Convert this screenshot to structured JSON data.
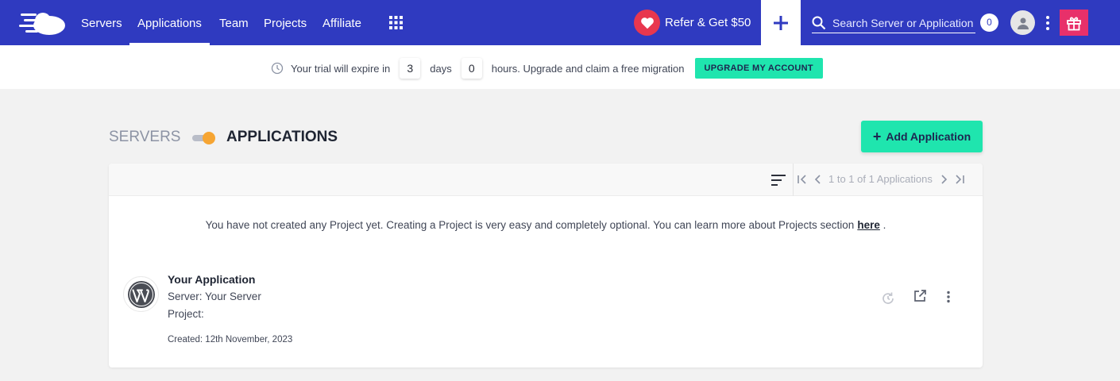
{
  "nav": {
    "items": [
      "Servers",
      "Applications",
      "Team",
      "Projects",
      "Affiliate"
    ],
    "active": "Applications",
    "refer_label": "Refer & Get $50",
    "search_placeholder": "Search Server or Application",
    "notification_count": "0"
  },
  "trial": {
    "prefix": "Your trial will expire in",
    "days_value": "3",
    "days_label": "days",
    "hours_value": "0",
    "hours_label": "hours. Upgrade and claim a free migration",
    "upgrade_label": "UPGRADE MY ACCOUNT"
  },
  "header": {
    "servers_label": "SERVERS",
    "applications_label": "APPLICATIONS",
    "add_button": "Add Application"
  },
  "list": {
    "pager_text": "1 to 1 of 1 Applications",
    "notice_text": "You have not created any Project yet. Creating a Project is very easy and completely optional. You can learn more about Projects section",
    "notice_link": "here",
    "notice_suffix": ".",
    "apps": [
      {
        "name": "Your Application",
        "server": "Server: Your Server",
        "project": "Project:",
        "created": "Created: 12th November, 2023",
        "icon": "wordpress-icon"
      }
    ]
  },
  "colors": {
    "topbar": "#2f3ac0",
    "accent_green": "#1fe5ae",
    "heart_red": "#e8374e",
    "gift_pink": "#e8306a",
    "toggle_orange": "#f6a533"
  }
}
